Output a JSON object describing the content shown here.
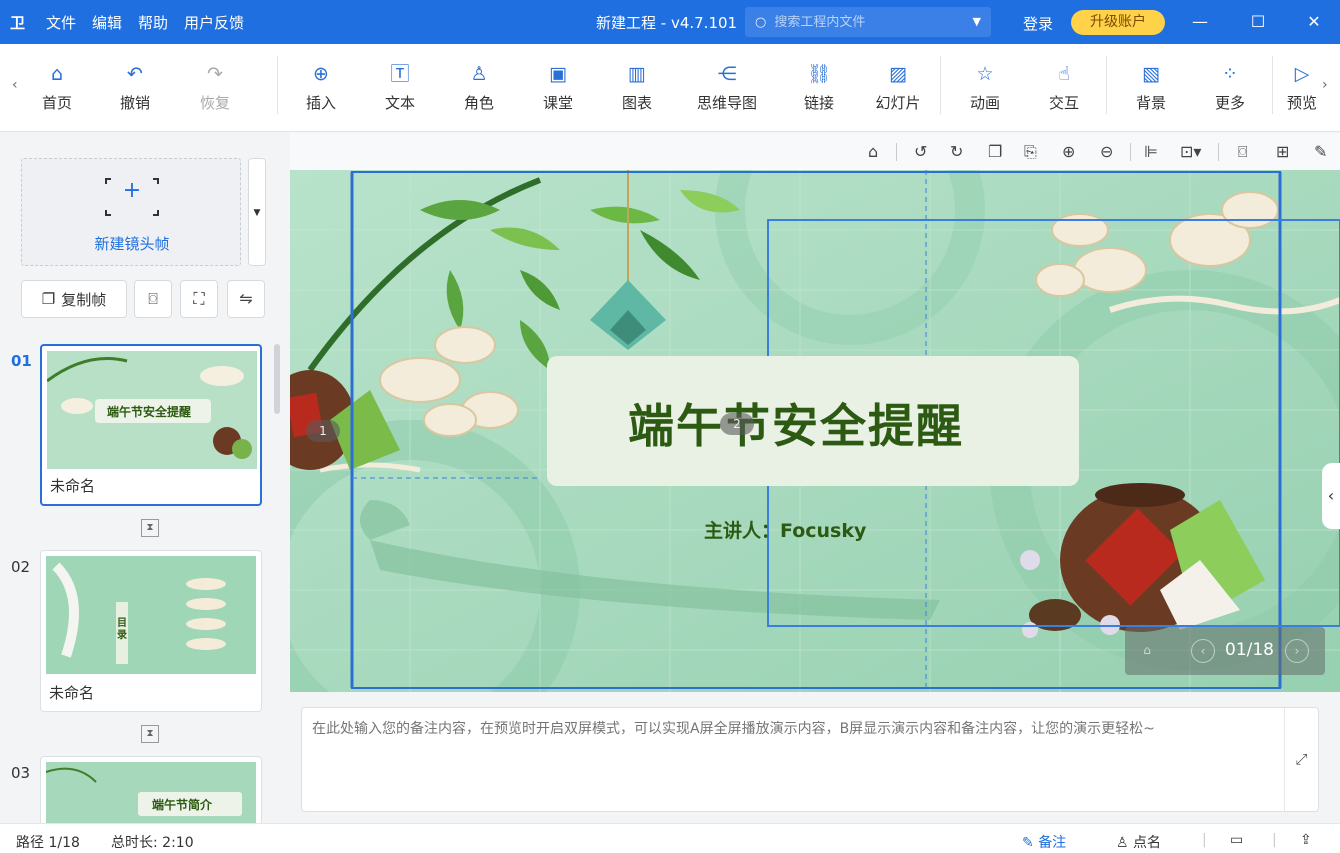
{
  "titlebar": {
    "app_icon": "卫",
    "menu": [
      "文件",
      "编辑",
      "帮助",
      "用户反馈"
    ],
    "title": "新建工程 - v4.7.101",
    "search_placeholder": "搜索工程内文件",
    "login": "登录",
    "upgrade": "升级账户"
  },
  "toolbar": {
    "items": [
      {
        "label": "首页",
        "icon": "home-icon"
      },
      {
        "label": "撤销",
        "icon": "undo-icon"
      },
      {
        "label": "恢复",
        "icon": "redo-icon"
      },
      {
        "label": "插入",
        "icon": "plus-circle-icon"
      },
      {
        "label": "文本",
        "icon": "text-icon"
      },
      {
        "label": "角色",
        "icon": "character-icon"
      },
      {
        "label": "课堂",
        "icon": "classroom-icon"
      },
      {
        "label": "图表",
        "icon": "chart-icon"
      },
      {
        "label": "思维导图",
        "icon": "mindmap-icon"
      },
      {
        "label": "链接",
        "icon": "link-icon"
      },
      {
        "label": "幻灯片",
        "icon": "slide-icon"
      },
      {
        "label": "动画",
        "icon": "star-icon"
      },
      {
        "label": "交互",
        "icon": "interaction-icon"
      },
      {
        "label": "背景",
        "icon": "background-icon"
      },
      {
        "label": "更多",
        "icon": "more-icon"
      },
      {
        "label": "预览",
        "icon": "preview-icon"
      }
    ]
  },
  "leftpanel": {
    "new_frame": "新建镜头帧",
    "copy_frame": "复制帧",
    "frames": [
      {
        "num": "01",
        "name": "未命名",
        "thumb_title": "端午节安全提醒"
      },
      {
        "num": "02",
        "name": "未命名",
        "thumb_title": "目录"
      },
      {
        "num": "03",
        "name": "",
        "thumb_title": "端午节简介"
      }
    ]
  },
  "canvas": {
    "title": "端午节安全提醒",
    "subtitle": "主讲人：Focusky",
    "badges": [
      "1",
      "2"
    ],
    "page": "01/18"
  },
  "notes": {
    "placeholder": "在此处输入您的备注内容，在预览时开启双屏模式，可以实现A屏全屏播放演示内容，B屏显示演示内容和备注内容，让您的演示更轻松~"
  },
  "status": {
    "path": "路径 1/18",
    "duration": "总时长: 2:10",
    "notes": "备注",
    "rollcall": "点名"
  },
  "colors": {
    "primary": "#1f6fe0",
    "upgrade": "#ffd24a",
    "title_green": "#2d5a12",
    "canvas_bg": "#a8d9be"
  }
}
